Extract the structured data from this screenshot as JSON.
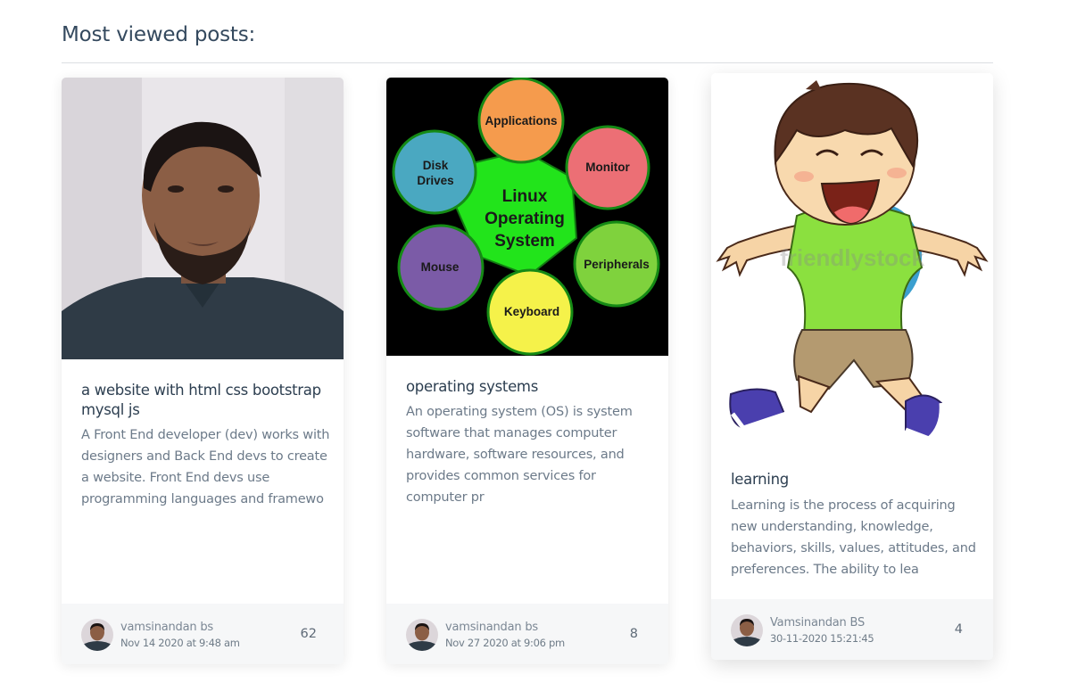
{
  "section": {
    "title": "Most viewed posts:"
  },
  "cards": [
    {
      "title": "a website with html css bootstrap mysql js",
      "excerpt": "A Front End developer (dev) works with designers and Back End devs to create a website. Front End devs use programming languages and framewo",
      "author": "vamsinandan bs",
      "date": "Nov 14 2020 at 9:48 am",
      "views": "62"
    },
    {
      "title": "operating systems",
      "excerpt": "An operating system (OS) is system software that manages computer hardware, software resources, and provides common services for computer pr",
      "author": "vamsinandan bs",
      "date": "Nov 27 2020 at 9:06 pm",
      "views": "8",
      "diagram": {
        "center": "Linux Operating System",
        "nodes": [
          "Applications",
          "Monitor",
          "Peripherals",
          "Keyboard",
          "Mouse",
          "Disk Drives"
        ]
      }
    },
    {
      "title": "learning",
      "excerpt": "Learning is the process of acquiring new understanding, knowledge, behaviors, skills, values, attitudes, and preferences. The ability to lea",
      "author": "Vamsinandan BS",
      "date": "30-11-2020 15:21:45",
      "views": "4",
      "watermark": "friendlystock"
    }
  ]
}
